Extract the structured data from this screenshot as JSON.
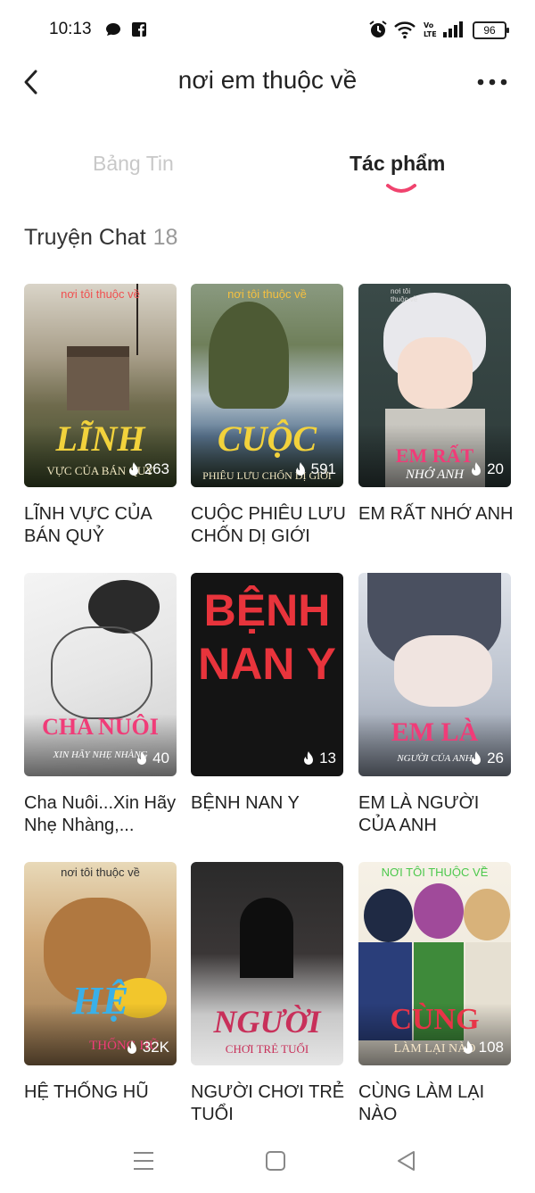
{
  "status_bar": {
    "time": "10:13",
    "battery": "96",
    "icons": [
      "chat-bubble-icon",
      "facebook-icon",
      "alarm-icon",
      "wifi-icon",
      "volte-icon",
      "signal-icon",
      "battery-icon"
    ]
  },
  "header": {
    "title": "nơi em thuộc về",
    "back_icon": "back-chevron-icon",
    "more_icon": "more-dots-icon"
  },
  "tabs": [
    {
      "label": "Bảng Tin",
      "active": false
    },
    {
      "label": "Tác phẩm",
      "active": true
    }
  ],
  "section": {
    "label": "Truyện Chat",
    "count": "18"
  },
  "accent_color": "#f0436e",
  "works": [
    {
      "title": "LĨNH VỰC CỦA BÁN QUỶ",
      "cover_tag": "nơi tôi thuộc về",
      "cover_big": "LĨNH",
      "cover_sub": "VỰC CỦA BÁN QUỶ",
      "count": "263"
    },
    {
      "title": "CUỘC PHIÊU LƯU CHỐN DỊ GIỚI",
      "cover_tag": "nơi tôi thuộc về",
      "cover_big": "CUỘC",
      "cover_sub": "PHIÊU LƯU CHỐN DỊ GIỚI",
      "count": "591"
    },
    {
      "title": "EM RẤT NHỚ ANH",
      "cover_tag": "nơi tôi thuộc về",
      "cover_big": "EM RẤT",
      "cover_sub": "NHỚ ANH",
      "count": "20"
    },
    {
      "title": "Cha Nuôi...Xin Hãy Nhẹ Nhàng,...",
      "cover_tag": "",
      "cover_big": "CHA NUÔI",
      "cover_sub": "XIN HÃY NHẸ NHÀNG",
      "count": "40"
    },
    {
      "title": "BỆNH NAN Y",
      "cover_tag": "",
      "cover_big": "BỆNH NAN Y",
      "cover_sub": "",
      "count": "13"
    },
    {
      "title": "EM LÀ NGƯỜI CỦA ANH",
      "cover_tag": "",
      "cover_big": "EM LÀ",
      "cover_sub": "NGƯỜI CỦA ANH",
      "count": "26"
    },
    {
      "title": "HỆ THỐNG HŨ",
      "cover_tag": "nơi tôi thuộc về",
      "cover_big": "HỆ",
      "cover_sub": "THỐNG HŨ",
      "count": "32K"
    },
    {
      "title": "NGƯỜI CHƠI TRẺ TUỔI",
      "cover_tag": "",
      "cover_big": "NGƯỜI",
      "cover_sub": "CHƠI TRẺ TUỔI",
      "count": ""
    },
    {
      "title": "CÙNG LÀM LẠI NÀO",
      "cover_tag": "NƠI TÔI THUỘC VỀ",
      "cover_big": "CÙNG",
      "cover_sub": "LÀM LẠI NÀO",
      "count": "108"
    }
  ],
  "bottom_nav": [
    "menu-icon",
    "home-square-icon",
    "back-triangle-icon"
  ]
}
